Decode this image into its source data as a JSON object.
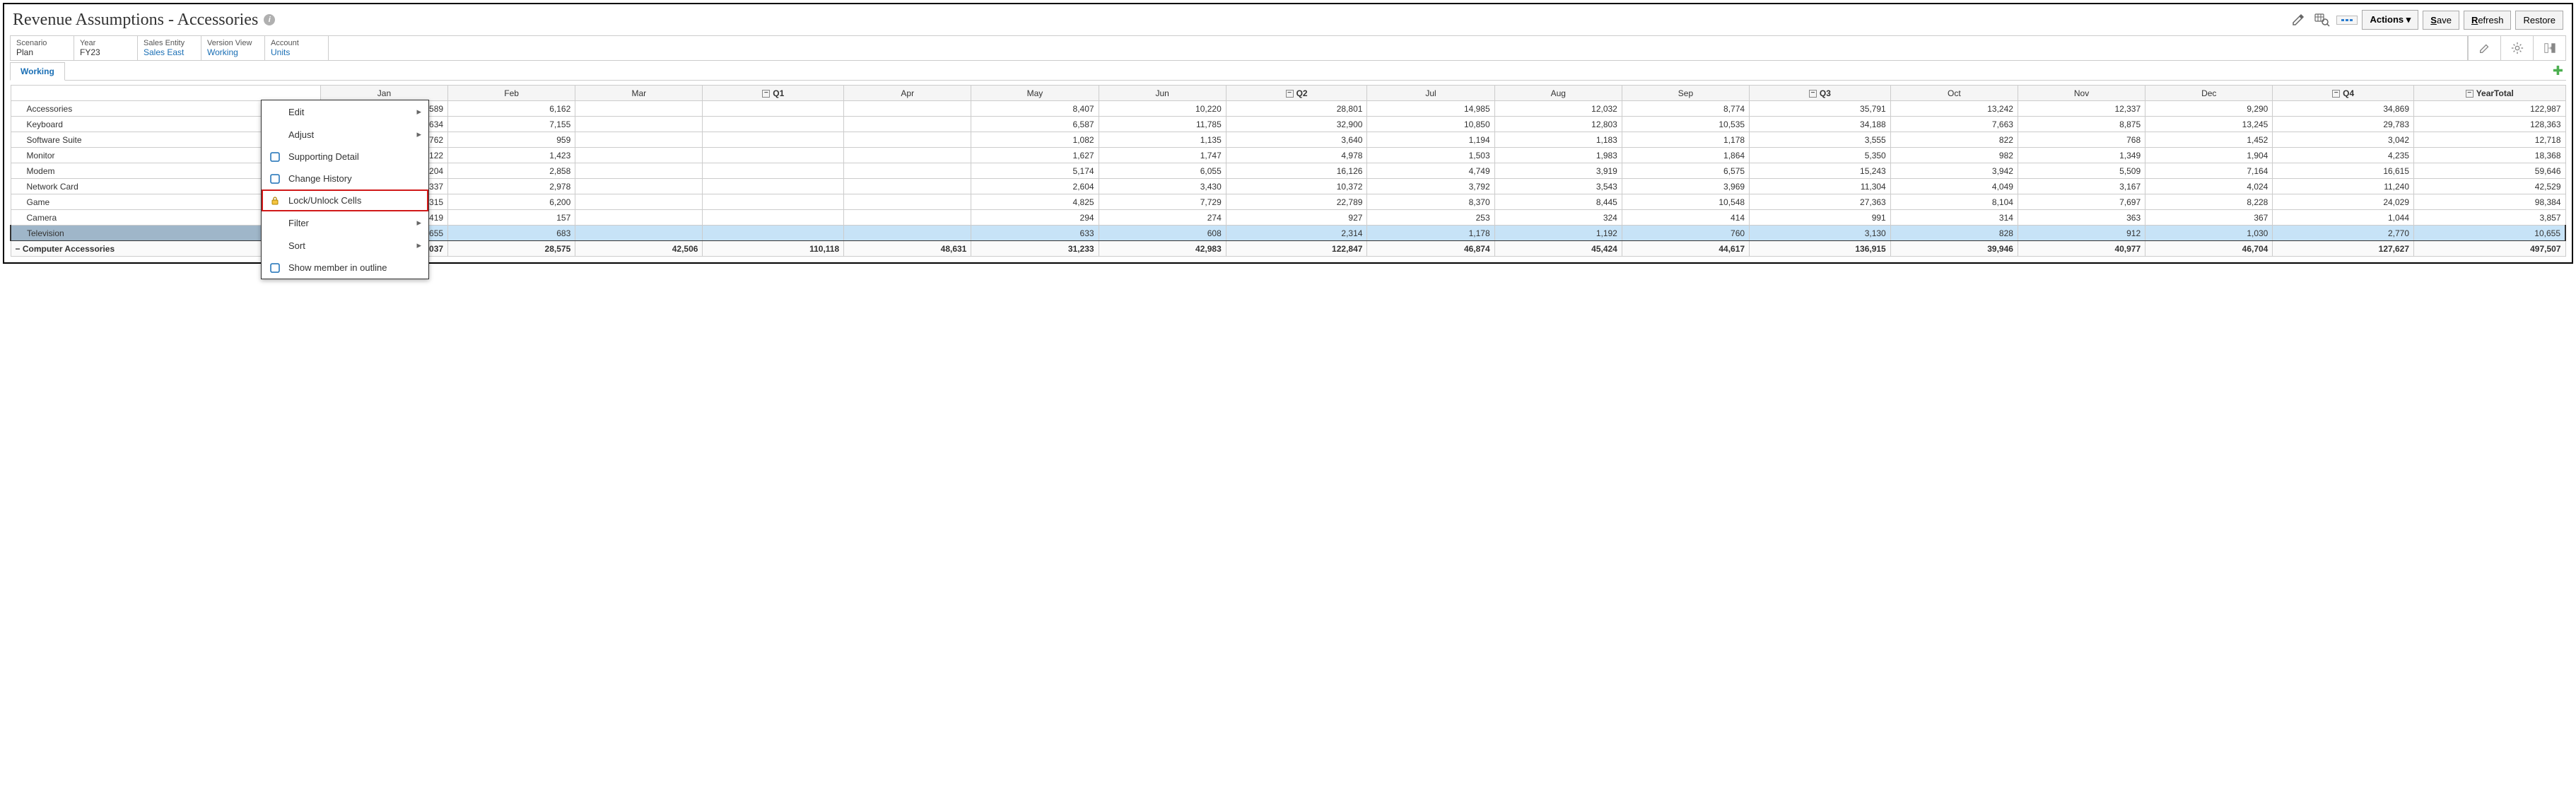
{
  "header": {
    "title": "Revenue Assumptions - Accessories"
  },
  "toolbar": {
    "actions_label": "Actions ▾",
    "save_label": "Save",
    "refresh_label": "Refresh",
    "restore_label": "Restore"
  },
  "pov": {
    "scenario_label": "Scenario",
    "scenario_value": "Plan",
    "year_label": "Year",
    "year_value": "FY23",
    "sales_entity_label": "Sales Entity",
    "sales_entity_value": "Sales East",
    "version_label": "Version View",
    "version_value": "Working",
    "account_label": "Account",
    "account_value": "Units"
  },
  "tabs": {
    "working": "Working"
  },
  "columns": [
    "Jan",
    "Feb",
    "Mar",
    "Q1",
    "Apr",
    "May",
    "Jun",
    "Q2",
    "Jul",
    "Aug",
    "Sep",
    "Q3",
    "Oct",
    "Nov",
    "Dec",
    "Q4",
    "YearTotal"
  ],
  "quarterCols": [
    3,
    7,
    11,
    15,
    16
  ],
  "rows": [
    {
      "label": "Accessories",
      "values": [
        "8,589",
        "6,162",
        "",
        "",
        "",
        "8,407",
        "10,220",
        "28,801",
        "14,985",
        "12,032",
        "8,774",
        "35,791",
        "13,242",
        "12,337",
        "9,290",
        "34,869",
        "122,987"
      ]
    },
    {
      "label": "Keyboard",
      "values": [
        "10,634",
        "7,155",
        "",
        "",
        "",
        "6,587",
        "11,785",
        "32,900",
        "10,850",
        "12,803",
        "10,535",
        "34,188",
        "7,663",
        "8,875",
        "13,245",
        "29,783",
        "128,363"
      ]
    },
    {
      "label": "Software Suite",
      "values": [
        "762",
        "959",
        "",
        "",
        "",
        "1,082",
        "1,135",
        "3,640",
        "1,194",
        "1,183",
        "1,178",
        "3,555",
        "822",
        "768",
        "1,452",
        "3,042",
        "12,718"
      ]
    },
    {
      "label": "Monitor",
      "values": [
        "1,122",
        "1,423",
        "",
        "",
        "",
        "1,627",
        "1,747",
        "4,978",
        "1,503",
        "1,983",
        "1,864",
        "5,350",
        "982",
        "1,349",
        "1,904",
        "4,235",
        "18,368"
      ]
    },
    {
      "label": "Modem",
      "values": [
        "4,204",
        "2,858",
        "",
        "",
        "",
        "5,174",
        "6,055",
        "16,126",
        "4,749",
        "3,919",
        "6,575",
        "15,243",
        "3,942",
        "5,509",
        "7,164",
        "16,615",
        "59,646"
      ]
    },
    {
      "label": "Network Card",
      "values": [
        "4,337",
        "2,978",
        "",
        "",
        "",
        "2,604",
        "3,430",
        "10,372",
        "3,792",
        "3,543",
        "3,969",
        "11,304",
        "4,049",
        "3,167",
        "4,024",
        "11,240",
        "42,529"
      ]
    },
    {
      "label": "Game",
      "values": [
        "8,315",
        "6,200",
        "",
        "",
        "",
        "4,825",
        "7,729",
        "22,789",
        "8,370",
        "8,445",
        "10,548",
        "27,363",
        "8,104",
        "7,697",
        "8,228",
        "24,029",
        "98,384"
      ]
    },
    {
      "label": "Camera",
      "values": [
        "419",
        "157",
        "",
        "",
        "",
        "294",
        "274",
        "927",
        "253",
        "324",
        "414",
        "991",
        "314",
        "363",
        "367",
        "1,044",
        "3,857"
      ]
    },
    {
      "label": "Television",
      "selected": true,
      "values": [
        "655",
        "683",
        "",
        "",
        "",
        "633",
        "608",
        "2,314",
        "1,178",
        "1,192",
        "760",
        "3,130",
        "828",
        "912",
        "1,030",
        "2,770",
        "10,655"
      ]
    }
  ],
  "totalRow": {
    "label": "Computer Accessories",
    "values": [
      "39,037",
      "28,575",
      "42,506",
      "110,118",
      "48,631",
      "31,233",
      "42,983",
      "122,847",
      "46,874",
      "45,424",
      "44,617",
      "136,915",
      "39,946",
      "40,977",
      "46,704",
      "127,627",
      "497,507"
    ]
  },
  "contextMenu": {
    "items": [
      {
        "label": "Edit",
        "arrow": true
      },
      {
        "label": "Adjust",
        "arrow": true
      },
      {
        "label": "Supporting Detail",
        "iconColor": "#1a6fb5"
      },
      {
        "label": "Change History",
        "iconColor": "#1a6fb5"
      },
      {
        "label": "Lock/Unlock Cells",
        "highlight": true,
        "iconColor": "#d9a300"
      },
      {
        "label": "Filter",
        "arrow": true
      },
      {
        "label": "Sort",
        "arrow": true
      },
      {
        "label": "Show member in outline",
        "iconColor": "#1a6fb5"
      }
    ]
  }
}
